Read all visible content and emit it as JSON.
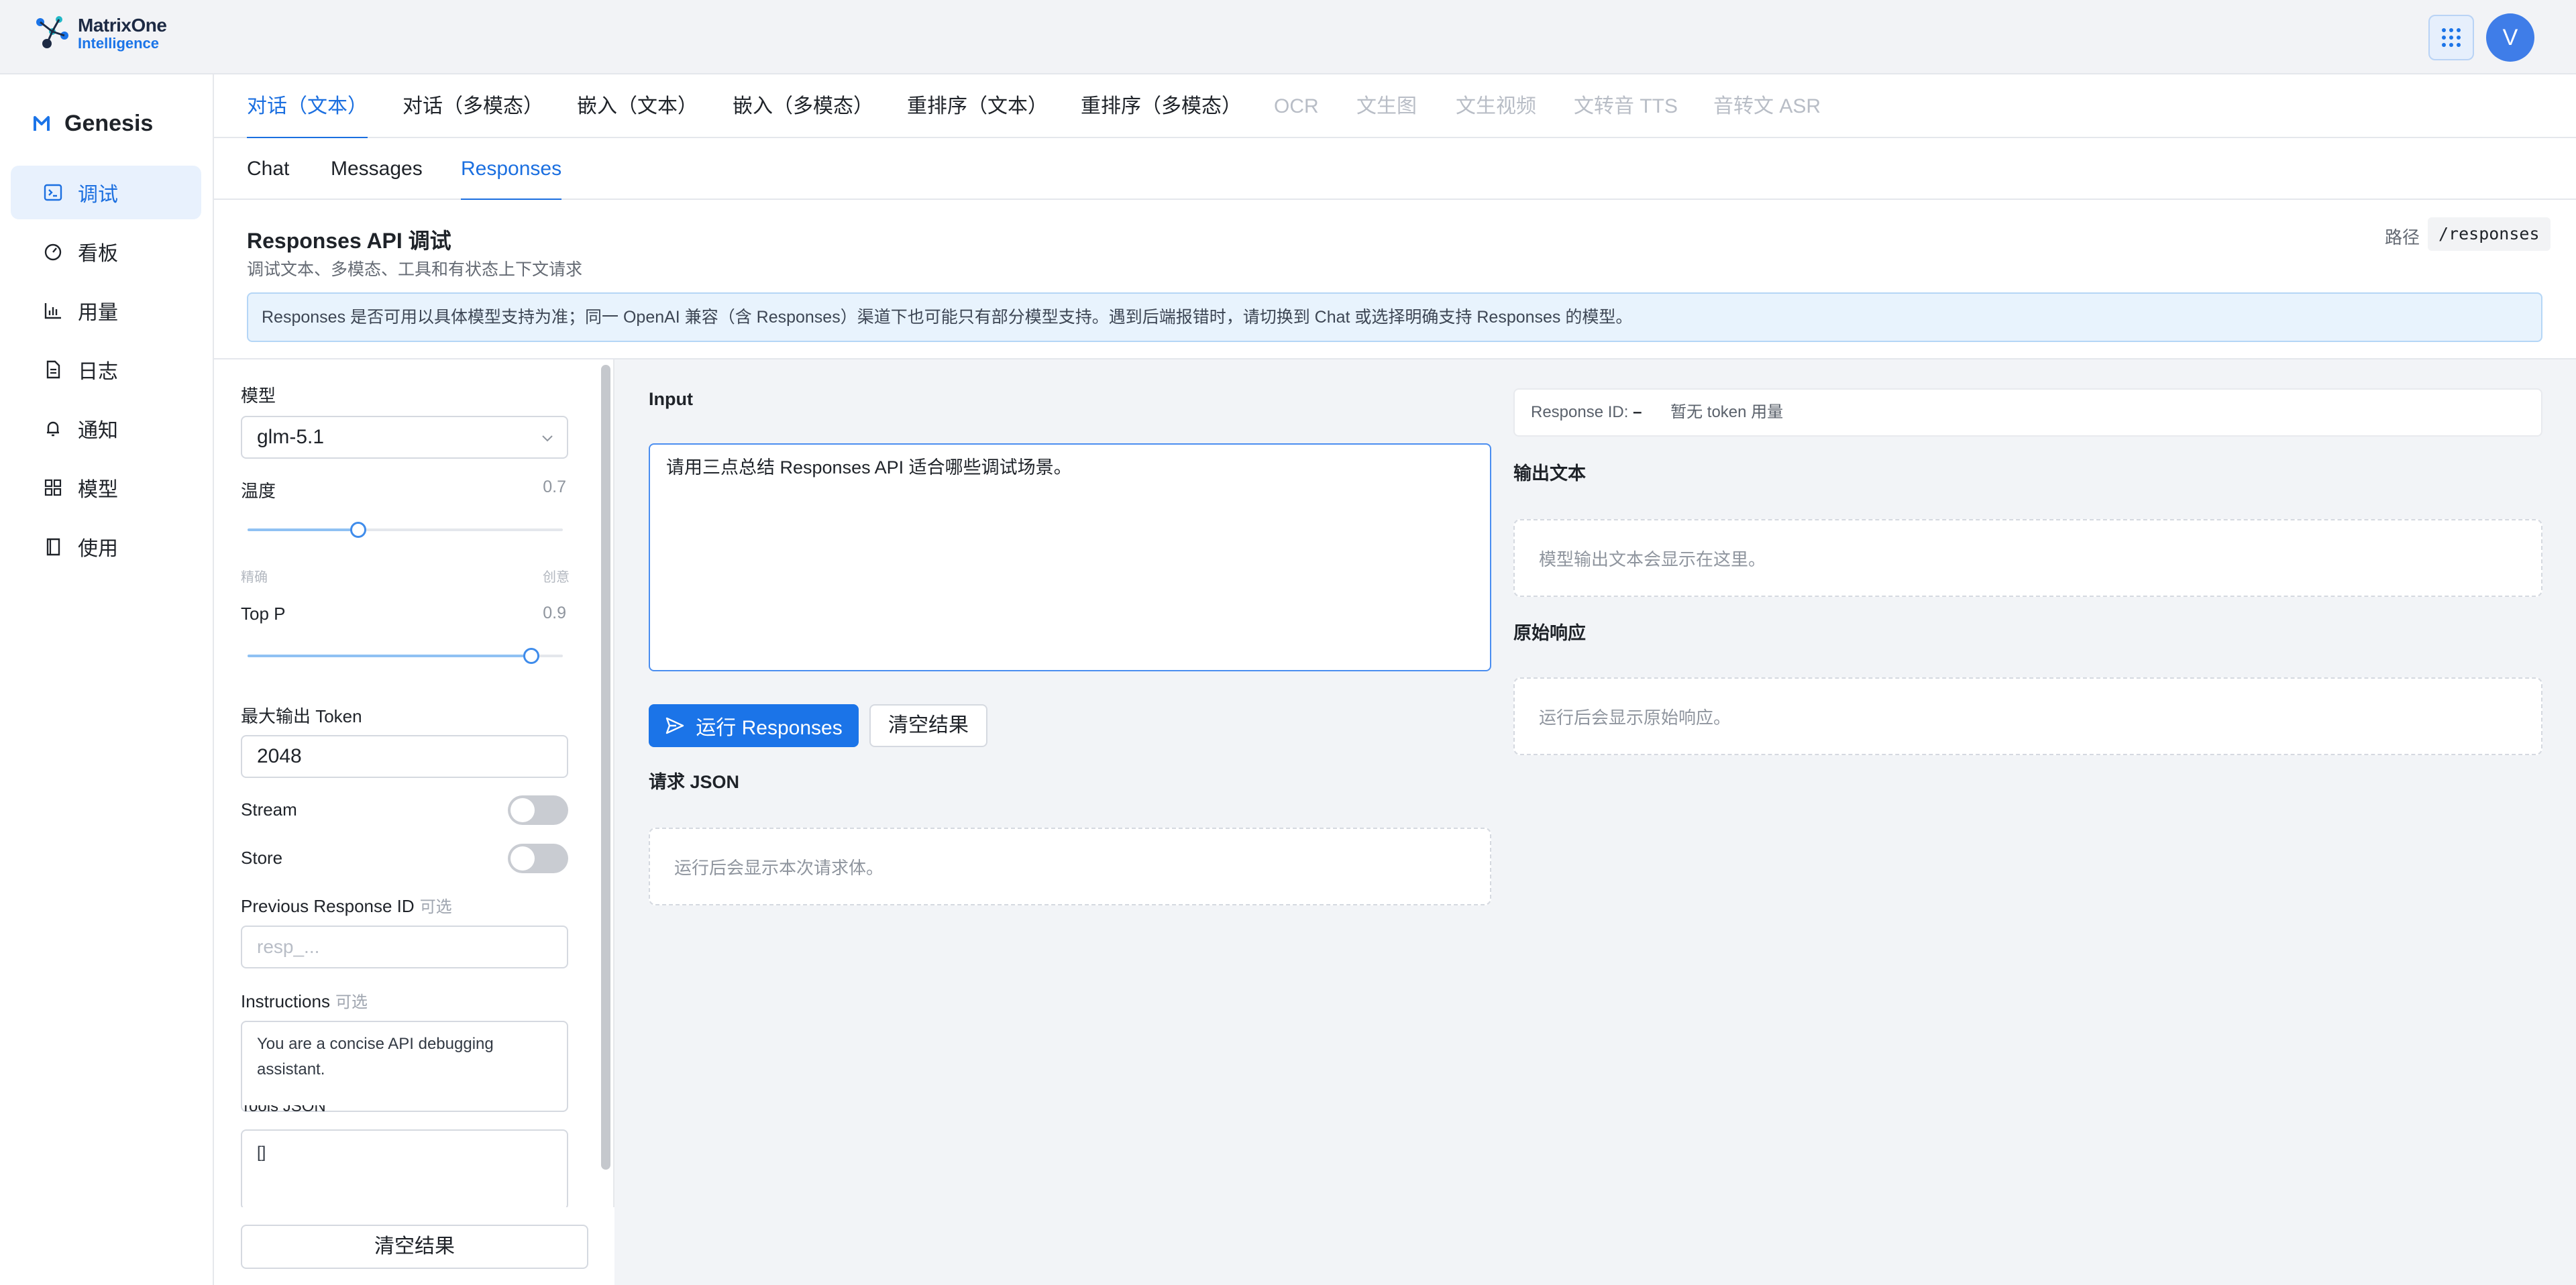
{
  "brand": {
    "logo_line1": "MatrixOne",
    "logo_line2": "Intelligence",
    "app_name": "Genesis"
  },
  "user": {
    "avatar_initial": "V"
  },
  "sidebar": {
    "items": [
      {
        "label": "调试",
        "icon": "terminal-icon",
        "active": true
      },
      {
        "label": "看板",
        "icon": "dashboard-icon"
      },
      {
        "label": "用量",
        "icon": "bar-chart-icon"
      },
      {
        "label": "日志",
        "icon": "document-icon"
      },
      {
        "label": "通知",
        "icon": "bell-icon"
      },
      {
        "label": "模型",
        "icon": "grid-icon"
      },
      {
        "label": "使用",
        "icon": "book-icon"
      }
    ]
  },
  "tabs_main": [
    {
      "label": "对话（文本）",
      "active": true
    },
    {
      "label": "对话（多模态）"
    },
    {
      "label": "嵌入（文本）"
    },
    {
      "label": "嵌入（多模态）"
    },
    {
      "label": "重排序（文本）"
    },
    {
      "label": "重排序（多模态）"
    },
    {
      "label": "OCR",
      "disabled": true
    },
    {
      "label": "文生图",
      "disabled": true
    },
    {
      "label": "文生视频",
      "disabled": true
    },
    {
      "label": "文转音 TTS",
      "disabled": true
    },
    {
      "label": "音转文 ASR",
      "disabled": true
    }
  ],
  "tabs_sub": [
    {
      "label": "Chat"
    },
    {
      "label": "Messages"
    },
    {
      "label": "Responses",
      "active": true
    }
  ],
  "header": {
    "title": "Responses API 调试",
    "subtitle": "调试文本、多模态、工具和有状态上下文请求",
    "path_label": "路径",
    "path_value": "/responses",
    "notice": "Responses 是否可用以具体模型支持为准；同一 OpenAI 兼容（含 Responses）渠道下也可能只有部分模型支持。遇到后端报错时，请切换到 Chat 或选择明确支持 Responses 的模型。"
  },
  "params": {
    "model_label": "模型",
    "model_value": "glm-5.1",
    "temperature_label": "温度",
    "temperature_value": "0.7",
    "temperature_fraction": 0.35,
    "temperature_min_caption": "精确",
    "temperature_max_caption": "创意",
    "top_p_label": "Top P",
    "top_p_value": "0.9",
    "top_p_fraction": 0.9,
    "max_tokens_label": "最大输出 Token",
    "max_tokens_value": "2048",
    "stream_label": "Stream",
    "store_label": "Store",
    "prev_id_label": "Previous Response ID",
    "prev_id_optional": "可选",
    "prev_id_placeholder": "resp_...",
    "instructions_label": "Instructions",
    "instructions_optional": "可选",
    "instructions_value": "You are a concise API debugging assistant.",
    "tools_label": "Tools JSON",
    "tools_value": "[]",
    "clear_button": "清空结果"
  },
  "input_panel": {
    "label": "Input",
    "value": "请用三点总结 Responses API 适合哪些调试场景。",
    "run_button": "运行 Responses",
    "clear_button": "清空结果",
    "request_json_label": "请求 JSON",
    "request_json_placeholder": "运行后会显示本次请求体。"
  },
  "output_panel": {
    "response_id_label": "Response ID:",
    "response_id_value": "–",
    "token_usage": "暂无 token 用量",
    "output_text_label": "输出文本",
    "output_text_placeholder": "模型输出文本会显示在这里。",
    "raw_label": "原始响应",
    "raw_placeholder": "运行后会显示原始响应。"
  }
}
